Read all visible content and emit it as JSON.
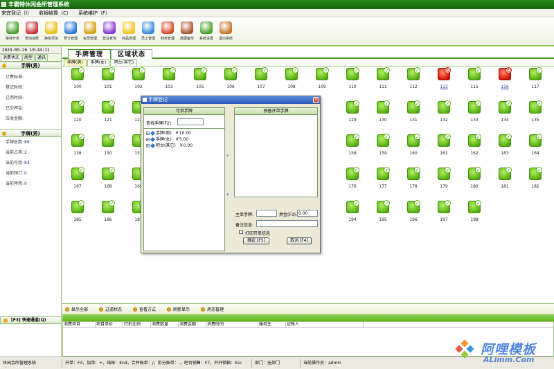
{
  "window": {
    "title": "丰霸特休闲会所管理系统"
  },
  "menu": [
    "来宾登记（I）",
    "收银结算（C）",
    "系统维护（F）"
  ],
  "toolbar": [
    {
      "label": "接待开单",
      "color": "#4aa32a"
    },
    {
      "label": "增加消费",
      "color": "#c8343a"
    },
    {
      "label": "换房添加",
      "color": "#e8c21a"
    },
    {
      "label": "预订管理",
      "color": "#2a7ad8"
    },
    {
      "label": "会员管理",
      "color": "#d8a21a"
    },
    {
      "label": "营业查询",
      "color": "#8a3ad8"
    },
    {
      "label": "商品管理",
      "color": "#f2c41a"
    },
    {
      "label": "员工管理",
      "color": "#3a8ad8"
    },
    {
      "label": "财务管理",
      "color": "#d84a2a"
    },
    {
      "label": "数据备份",
      "color": "#a8542a"
    },
    {
      "label": "系统设置",
      "color": "#4aa32a"
    },
    {
      "label": "退出系统",
      "color": "#c8742a"
    }
  ],
  "left": {
    "clock": "2023-09-26 10:44:11",
    "tabs": [
      "消费状态",
      "房型",
      "通讯"
    ],
    "section1_title": "手牌(男)",
    "fields1": [
      "计费标准:",
      "登记时间:",
      "已用时间:",
      "已交押金:",
      "应收金额:"
    ],
    "section2_title": "手牌(男)",
    "stats": [
      {
        "label": "手牌总数:",
        "value": "86"
      },
      {
        "label": "当前占用:",
        "value": "2"
      },
      {
        "label": "当前可用:",
        "value": "84"
      },
      {
        "label": "当前预订:",
        "value": "0"
      },
      {
        "label": "当前停用:",
        "value": "0"
      }
    ],
    "quick_channel": "[F3] 快速通道(Q)"
  },
  "main": {
    "tabs": [
      "手牌管理",
      "区域状态"
    ],
    "subtabs": [
      "手牌(男)",
      "手牌(女)",
      "吧台(其它)"
    ],
    "rooms": [
      {
        "no": "100",
        "busy": false
      },
      {
        "no": "101",
        "busy": false
      },
      {
        "no": "102",
        "busy": false
      },
      {
        "no": "103",
        "busy": false
      },
      {
        "no": "105",
        "busy": false
      },
      {
        "no": "106",
        "busy": false
      },
      {
        "no": "107",
        "busy": false
      },
      {
        "no": "108",
        "busy": false
      },
      {
        "no": "109",
        "busy": false
      },
      {
        "no": "110",
        "busy": false
      },
      {
        "no": "111",
        "busy": false
      },
      {
        "no": "112",
        "busy": false
      },
      {
        "no": "113",
        "busy": true
      },
      {
        "no": "115",
        "busy": false
      },
      {
        "no": "116",
        "busy": true
      },
      {
        "no": "117",
        "busy": false
      },
      {
        "no": "120",
        "busy": false
      },
      {
        "no": "121",
        "busy": false
      },
      {
        "no": "122",
        "busy": false
      },
      {
        "no": "",
        "busy": false
      },
      {
        "no": "",
        "busy": false
      },
      {
        "no": "",
        "busy": false
      },
      {
        "no": "",
        "busy": false
      },
      {
        "no": "",
        "busy": false
      },
      {
        "no": "",
        "busy": false
      },
      {
        "no": "129",
        "busy": false
      },
      {
        "no": "130",
        "busy": false
      },
      {
        "no": "131",
        "busy": false
      },
      {
        "no": "132",
        "busy": false
      },
      {
        "no": "133",
        "busy": false
      },
      {
        "no": "134",
        "busy": false
      },
      {
        "no": "135",
        "busy": false
      },
      {
        "no": "138",
        "busy": false
      },
      {
        "no": "150",
        "busy": false
      },
      {
        "no": "151",
        "busy": false
      },
      {
        "no": "",
        "busy": false
      },
      {
        "no": "",
        "busy": false
      },
      {
        "no": "",
        "busy": false
      },
      {
        "no": "",
        "busy": false
      },
      {
        "no": "",
        "busy": false
      },
      {
        "no": "",
        "busy": false
      },
      {
        "no": "158",
        "busy": false
      },
      {
        "no": "159",
        "busy": false
      },
      {
        "no": "160",
        "busy": false
      },
      {
        "no": "161",
        "busy": false
      },
      {
        "no": "162",
        "busy": false
      },
      {
        "no": "163",
        "busy": false
      },
      {
        "no": "164",
        "busy": false
      },
      {
        "no": "167",
        "busy": false
      },
      {
        "no": "168",
        "busy": false
      },
      {
        "no": "169",
        "busy": false
      },
      {
        "no": "",
        "busy": false
      },
      {
        "no": "",
        "busy": false
      },
      {
        "no": "",
        "busy": false
      },
      {
        "no": "",
        "busy": false
      },
      {
        "no": "",
        "busy": false
      },
      {
        "no": "",
        "busy": false
      },
      {
        "no": "176",
        "busy": false
      },
      {
        "no": "177",
        "busy": false
      },
      {
        "no": "178",
        "busy": false
      },
      {
        "no": "179",
        "busy": false
      },
      {
        "no": "180",
        "busy": false
      },
      {
        "no": "181",
        "busy": false
      },
      {
        "no": "182",
        "busy": false
      },
      {
        "no": "185",
        "busy": false
      },
      {
        "no": "186",
        "busy": false
      },
      {
        "no": "187",
        "busy": false
      },
      {
        "no": "",
        "busy": false
      },
      {
        "no": "",
        "busy": false
      },
      {
        "no": "",
        "busy": false
      },
      {
        "no": "",
        "busy": false
      },
      {
        "no": "",
        "busy": false
      },
      {
        "no": "",
        "busy": false
      },
      {
        "no": "194",
        "busy": false
      },
      {
        "no": "195",
        "busy": false
      },
      {
        "no": "196",
        "busy": false
      },
      {
        "no": "197",
        "busy": false
      },
      {
        "no": "198",
        "busy": false
      }
    ]
  },
  "dialog": {
    "title": "手牌登记",
    "left_header": "可供手牌",
    "search_label": "查找手牌(F2):",
    "tree": [
      {
        "name": "手牌(男)",
        "price": "￥10.00"
      },
      {
        "name": "手牌(女)",
        "price": "￥5.00"
      },
      {
        "name": "吧台(其它)",
        "price": "￥0.00"
      }
    ],
    "right_header": "预备开单手牌",
    "main_card_label": "主单手牌:",
    "deposit_label": "押金(F3):",
    "deposit_value": "0.00",
    "remark_label": "备注信息:",
    "print_label": "打印开单信息",
    "ok_label": "确定 [F5]",
    "cancel_label": "取消 [F4]"
  },
  "actions": [
    "显示全部",
    "过滤状态",
    "查看方式",
    "刷新显示",
    "房态管理"
  ],
  "table_headers": [
    "消费项目",
    "项目单价",
    "打折比例",
    "消费数量",
    "消费金额",
    "消费时间",
    "服务生",
    "记账人"
  ],
  "status": [
    "休闲会所管理系统",
    "开单：F4，加单：+，结账：End，合并账单：/，拆分账单：-，吧台销售：F7，开开锁箱：Esc",
    "部门：无部门",
    "当前操作员：admin"
  ],
  "watermark": {
    "text": "阿哩模板",
    "sub": "ALimm.Com"
  }
}
